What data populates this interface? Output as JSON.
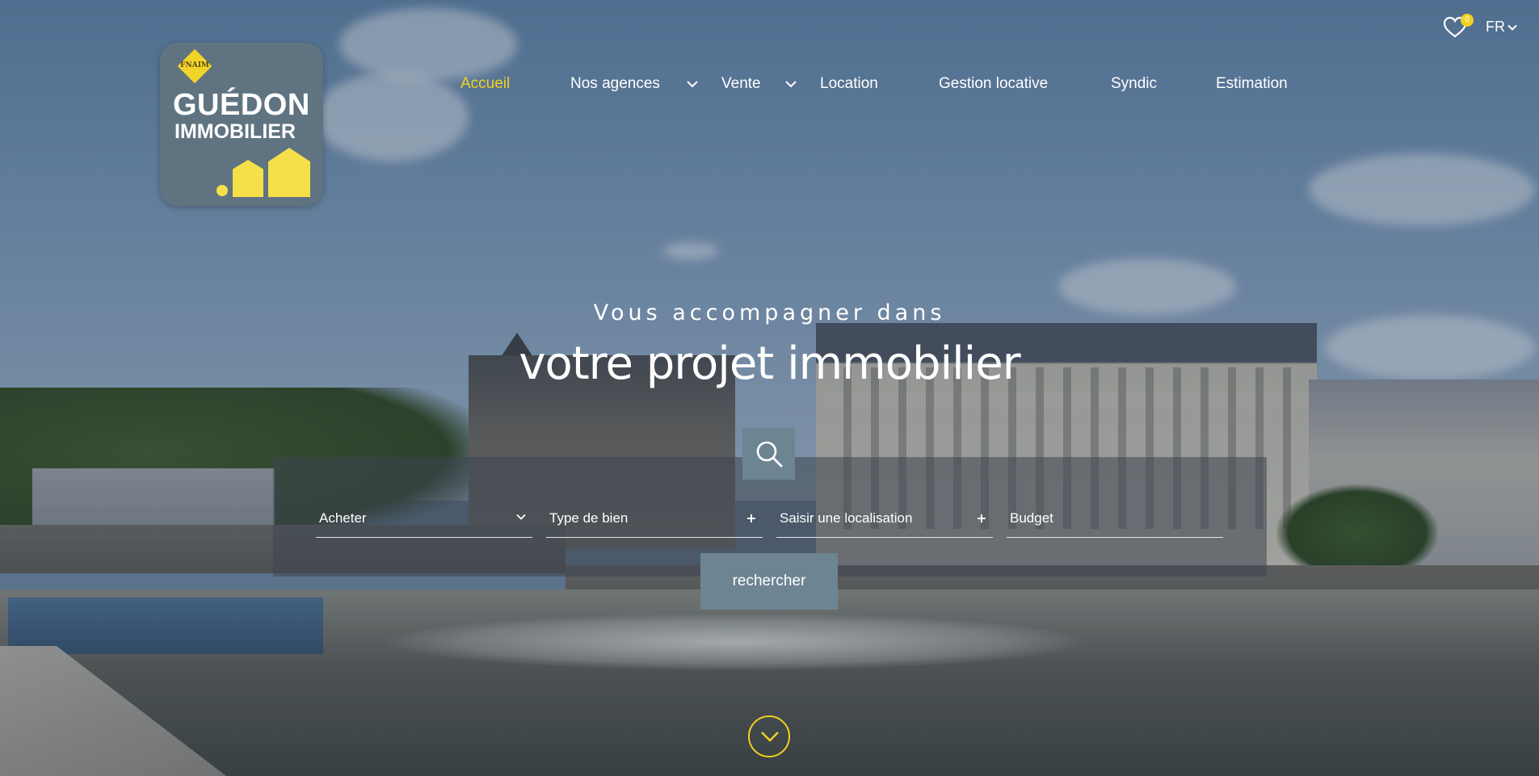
{
  "brand": {
    "badge": "FNAIM",
    "name_line1": "GUÉDON",
    "name_line2": "IMMOBILIER",
    "accent_color": "#f1d11f",
    "panel_color": "#6d8492"
  },
  "nav": {
    "items": [
      {
        "label": "Accueil",
        "active": true,
        "has_dropdown": false
      },
      {
        "label": "Nos agences",
        "active": false,
        "has_dropdown": true
      },
      {
        "label": "Vente",
        "active": false,
        "has_dropdown": true
      },
      {
        "label": "Location",
        "active": false,
        "has_dropdown": false
      },
      {
        "label": "Gestion locative",
        "active": false,
        "has_dropdown": false
      },
      {
        "label": "Syndic",
        "active": false,
        "has_dropdown": false
      },
      {
        "label": "Estimation",
        "active": false,
        "has_dropdown": false
      }
    ]
  },
  "topbar": {
    "favorites_icon": "heart-icon",
    "favorites_count": "0",
    "language": "FR"
  },
  "hero": {
    "subtitle": "Vous accompagner dans",
    "title": "votre projet immobilier"
  },
  "search": {
    "icon": "search-icon",
    "fields": [
      {
        "label": "Acheter",
        "indicator": "chevron-down-icon"
      },
      {
        "label": "Type de bien",
        "indicator": "plus-icon"
      },
      {
        "label": "Saisir une localisation",
        "indicator": "plus-icon"
      },
      {
        "label": "Budget",
        "indicator": ""
      }
    ],
    "submit_label": "rechercher"
  },
  "scroll": {
    "icon": "chevron-down-icon"
  }
}
